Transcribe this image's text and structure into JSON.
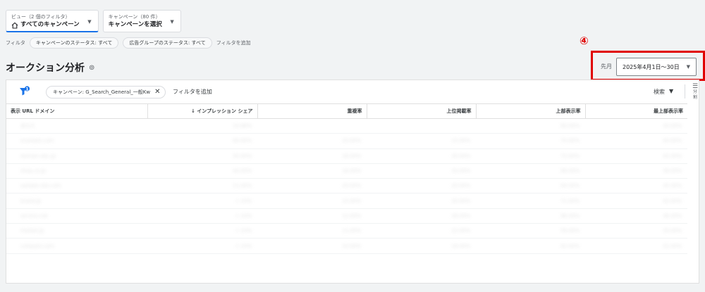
{
  "view_selector": {
    "sublabel": "ビュー（2 個のフィルタ）",
    "label": "すべてのキャンペーン"
  },
  "campaign_selector": {
    "sublabel": "キャンペーン（80 件）",
    "label": "キャンペーンを選択"
  },
  "filters": {
    "label": "フィルタ",
    "chips": [
      "キャンペーンのステータス: すべて",
      "広告グループのステータス: すべて"
    ],
    "add_label": "フィルタを追加"
  },
  "page_title": "オークション分析",
  "annotation": {
    "number": "④",
    "color": "#e00000"
  },
  "date_range": {
    "period_label": "先月",
    "value": "2025年4月1日～30日"
  },
  "table_toolbar": {
    "campaign_filter_chip": "キャンペーン: G_Search_General_一般Kw",
    "add_filter_label": "フィルタを追加",
    "search_label": "検索",
    "segment_label": "分割"
  },
  "table": {
    "columns": [
      "表示 URL ドメイン",
      "↓ インプレッション シェア",
      "重複率",
      "上位掲載率",
      "上部表示率",
      "最上部表示率"
    ],
    "rows": [
      [
        "あなた",
        "10.88%",
        "",
        "",
        "60.00%",
        "30.00%"
      ],
      [
        "example.com",
        "60.00%",
        "20.00%",
        "15.00%",
        "70.00%",
        "40.00%"
      ],
      [
        "domain-abc.jp",
        "50.00%",
        "18.00%",
        "30.00%",
        "72.00%",
        "45.00%"
      ],
      [
        "shop.co.jp",
        "40.00%",
        "16.00%",
        "25.00%",
        "68.00%",
        "38.00%"
      ],
      [
        "sample-site.com",
        "11.00%",
        "20.00%",
        "20.00%",
        "64.00%",
        "35.00%"
      ],
      [
        "brand.jp",
        "< 10%",
        "15.00%",
        "30.00%",
        "71.00%",
        "42.00%"
      ],
      [
        "service.net",
        "< 10%",
        "12.00%",
        "28.00%",
        "66.00%",
        "36.00%"
      ],
      [
        "market.jp",
        "< 10%",
        "11.00%",
        "22.00%",
        "59.00%",
        "33.00%"
      ],
      [
        "compare.com",
        "< 10%",
        "10.00%",
        "18.00%",
        "62.00%",
        "31.00%"
      ]
    ]
  },
  "colors": {
    "accent": "#1a73e8",
    "background": "#f1f3f4",
    "annotation_red": "#e00000"
  }
}
